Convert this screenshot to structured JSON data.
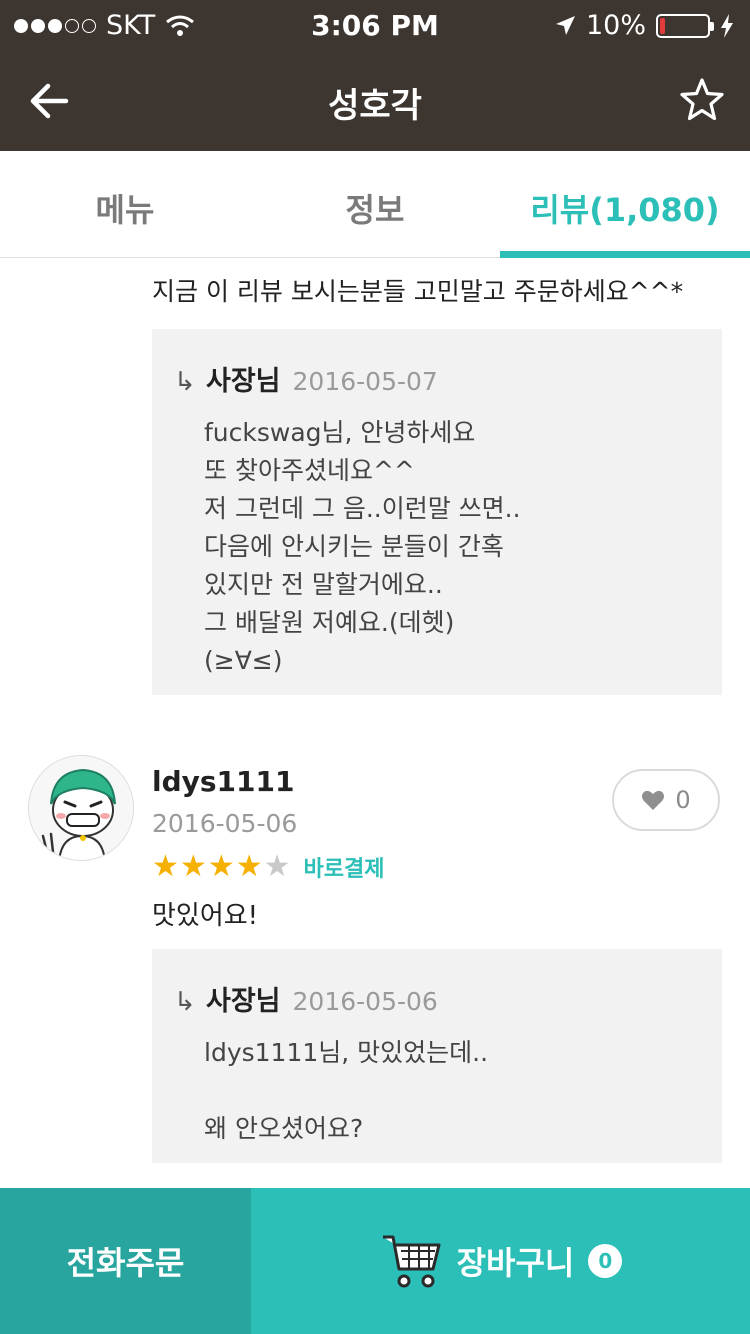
{
  "status_bar": {
    "carrier": "SKT",
    "time": "3:06 PM",
    "battery": "10%",
    "battery_level": 0.1
  },
  "nav": {
    "title": "성호각",
    "back_icon": "back-arrow-icon",
    "favorite_icon": "star-outline-icon"
  },
  "tabs": [
    {
      "label": "메뉴",
      "active": false
    },
    {
      "label": "정보",
      "active": false
    },
    {
      "label": "리뷰(1,080)",
      "active": true
    }
  ],
  "previous_review": {
    "text": "지금 이 리뷰 보시는분들 고민말고 주문하세요^^*",
    "reply": {
      "owner": "사장님",
      "date": "2016-05-07",
      "body": "fuckswag님, 안녕하세요\n또 찾아주셨네요^^\n저 그런데 그 음..이런말 쓰면..\n다음에 안시키는 분들이 간혹\n있지만 전 말할거에요..\n그 배달원 저예요.(데헷)\n(≥∀≤)"
    }
  },
  "review": {
    "user": "ldys1111",
    "date": "2016-05-06",
    "rating": 4,
    "rating_max": 5,
    "pay_badge": "바로결제",
    "text": "맛있어요!",
    "likes": "0",
    "reply": {
      "owner": "사장님",
      "date": "2016-05-06",
      "body": "ldys1111님, 맛있었는데..\n\n왜 안오셨어요?"
    }
  },
  "bottom_bar": {
    "call_order": "전화주문",
    "cart_label": "장바구니",
    "cart_count": "0"
  },
  "colors": {
    "header_bg": "#3d3530",
    "accent": "#2bbfb8",
    "accent_dark": "#28a59f",
    "star": "#f5b000"
  }
}
